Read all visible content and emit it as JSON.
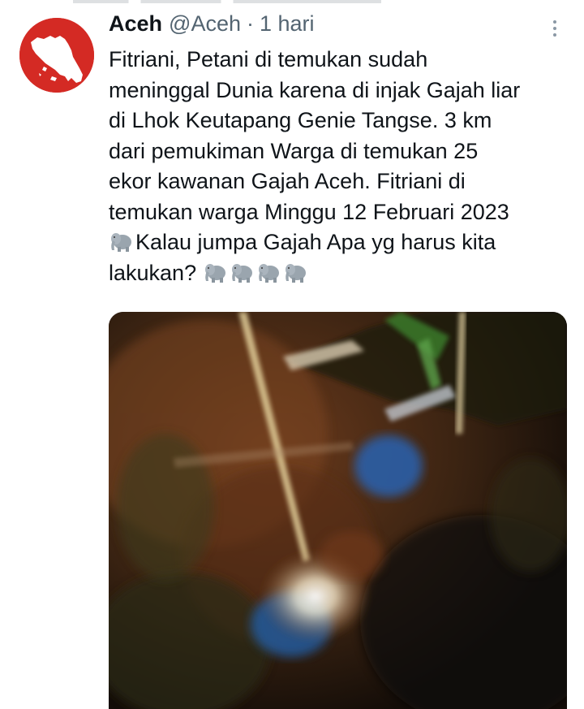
{
  "tweet": {
    "display_name": "Aceh",
    "handle": "@Aceh",
    "separator": "·",
    "time": "1 hari",
    "lines": [
      "Fitriani, Petani di temukan sudah",
      "meninggal Dunia karena di injak Gajah liar",
      "di Lhok Keutapang Genie Tangse. 3 km",
      "dari pemukiman Warga di temukan 25",
      "ekor kawanan Gajah Aceh. Fitriani di",
      "temukan warga Minggu 12 Februari 2023"
    ],
    "line7_text": "Kalau jumpa Gajah Apa yg harus kita",
    "line8_text": "lakukan?",
    "emoji": "elephant-emoji",
    "elephant_count_end": 4
  },
  "colors": {
    "avatar_red": "#d42a24",
    "secondary_text": "#536471",
    "primary_text": "#0f1419"
  },
  "icons": {
    "more": "more-vertical-icon",
    "avatar": "aceh-map-logo"
  }
}
